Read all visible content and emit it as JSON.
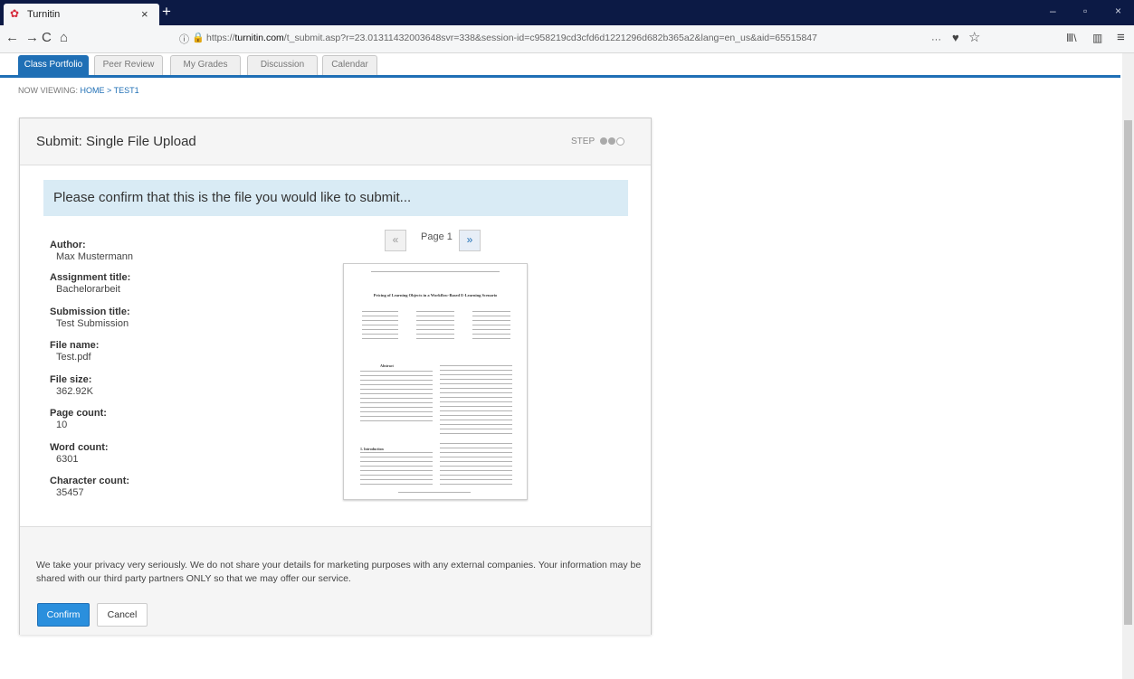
{
  "browser": {
    "tab_title": "Turnitin",
    "url_prefix": "https://",
    "url_host": "turnitin.com",
    "url_path": "/t_submit.asp?r=23.01311432003648svr=338&session-id=c958219cd3cfd6d1221296d682b365a2&lang=en_us&aid=65515847",
    "tab_close": "×",
    "new_tab": "+",
    "nav": {
      "back": "←",
      "forward": "→",
      "reload": "C",
      "home": "⌂"
    },
    "url_actions": {
      "more": "···",
      "pocket": "♥",
      "bookmark": "☆"
    },
    "tool_icons": {
      "library": "Ⅲ\\",
      "sidebar": "▥",
      "menu": "≡"
    },
    "window": {
      "minimize": "–",
      "restore": "▫",
      "close": "×"
    }
  },
  "page_tabs": [
    "Class Portfolio",
    "Peer Review",
    "My Grades",
    "Discussion",
    "Calendar"
  ],
  "breadcrumb": {
    "prefix": "NOW VIEWING:",
    "home": "HOME",
    "sep": ">",
    "current": "TEST1"
  },
  "panel": {
    "title": "Submit: Single File Upload",
    "step_label": "STEP",
    "confirm_message": "Please confirm that this is the file you would like to submit...",
    "meta": [
      {
        "key": "Author:",
        "value": "Max Mustermann"
      },
      {
        "key": "Assignment title:",
        "value": "Bachelorarbeit"
      },
      {
        "key": "Submission title:",
        "value": "Test Submission"
      },
      {
        "key": "File name:",
        "value": "Test.pdf"
      },
      {
        "key": "File size:",
        "value": "362.92K"
      },
      {
        "key": "Page count:",
        "value": "10"
      },
      {
        "key": "Word count:",
        "value": "6301"
      },
      {
        "key": "Character count:",
        "value": "35457"
      }
    ],
    "pager": {
      "prev": "«",
      "label": "Page 1",
      "next": "»"
    },
    "preview": {
      "doc_title": "Pricing of Learning Objects in a Workflow-Based E-Learning Scenario",
      "abstract": "Abstract",
      "intro": "1. Introduction"
    },
    "privacy": "We take your privacy very seriously. We do not share your details for marketing purposes with any external companies. Your information may be shared with our third party partners ONLY so that we may offer our service.",
    "confirm_label": "Confirm",
    "cancel_label": "Cancel"
  }
}
